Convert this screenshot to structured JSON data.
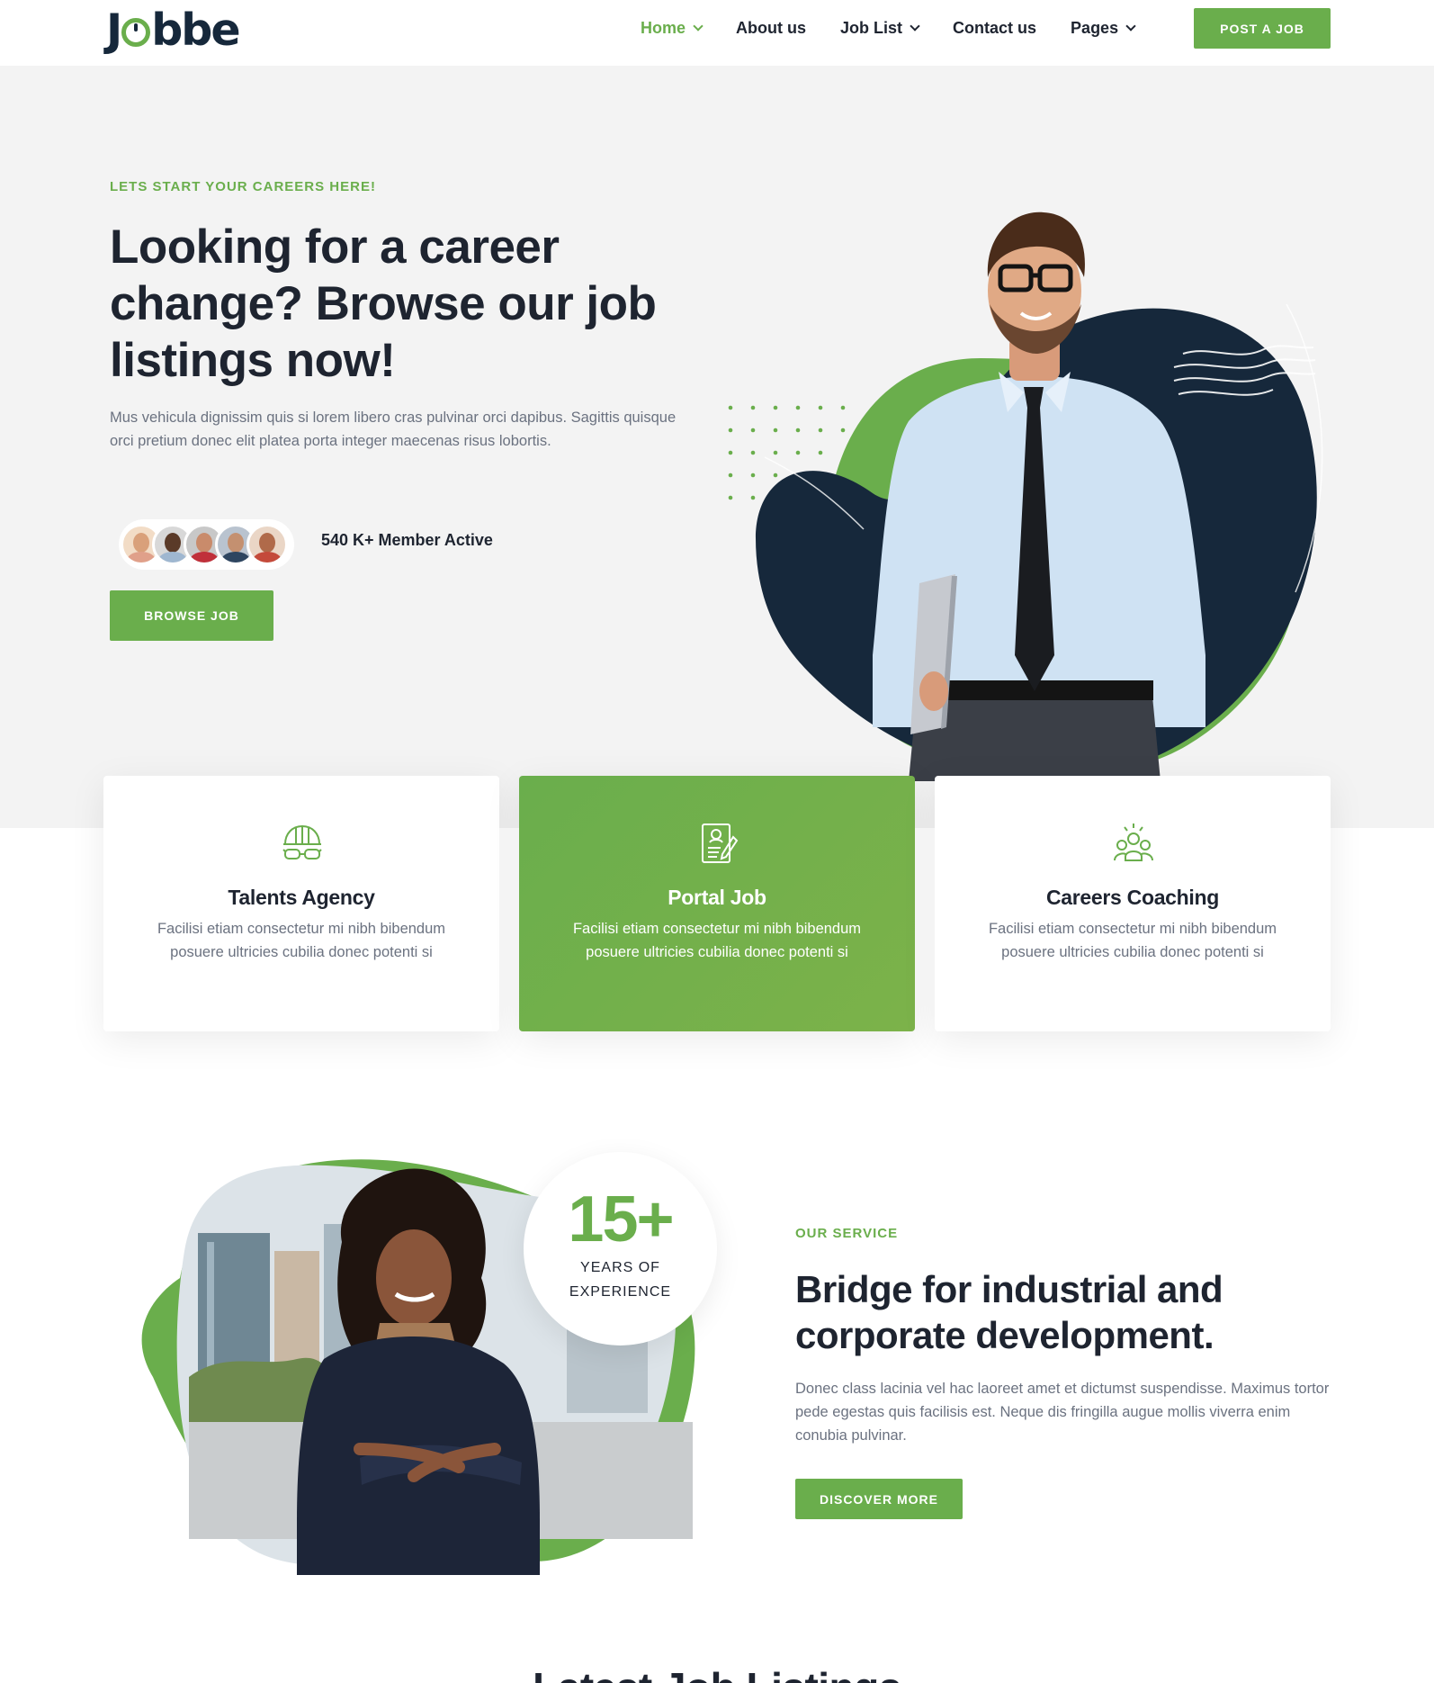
{
  "brand": {
    "logo_text": "Jobbe",
    "accent": "#6aae4c",
    "navy": "#16283b"
  },
  "nav": {
    "items": [
      {
        "label": "Home",
        "dropdown": true,
        "active": true
      },
      {
        "label": "About us",
        "dropdown": false
      },
      {
        "label": "Job List",
        "dropdown": true
      },
      {
        "label": "Contact us",
        "dropdown": false
      },
      {
        "label": "Pages",
        "dropdown": true
      }
    ],
    "cta": "POST A JOB"
  },
  "hero": {
    "eyebrow": "LETS START YOUR CAREERS HERE!",
    "title": "Looking for a career change? Browse our job listings now!",
    "description": "Mus vehicula dignissim quis si lorem libero cras pulvinar orci dapibus. Sagittis quisque orci pretium donec elit platea porta integer maecenas risus lobortis.",
    "member_text": "540 K+ Member Active",
    "button": "BROWSE JOB"
  },
  "cards": [
    {
      "icon": "helmet-goggles-icon",
      "title": "Talents Agency",
      "desc": "Facilisi etiam consectetur mi nibh bibendum posuere ultricies cubilia donec potenti si"
    },
    {
      "icon": "resume-document-icon",
      "title": "Portal Job",
      "desc": "Facilisi etiam consectetur mi nibh bibendum posuere ultricies cubilia donec potenti si"
    },
    {
      "icon": "team-coaching-icon",
      "title": "Careers Coaching",
      "desc": "Facilisi etiam consectetur mi nibh bibendum posuere ultricies cubilia donec potenti si"
    }
  ],
  "service": {
    "badge_number": "15+",
    "badge_line1": "YEARS OF",
    "badge_line2": "EXPERIENCE",
    "eyebrow": "OUR SERVICE",
    "title": "Bridge for industrial and corporate development.",
    "description": "Donec class lacinia vel hac laoreet amet et dictumst suspendisse. Maximus tortor pede egestas quis facilisis est. Neque dis fringilla augue mollis viverra enim conubia pulvinar.",
    "button": "DISCOVER MORE"
  },
  "next_section": {
    "heading": "Latest Job Listings"
  }
}
